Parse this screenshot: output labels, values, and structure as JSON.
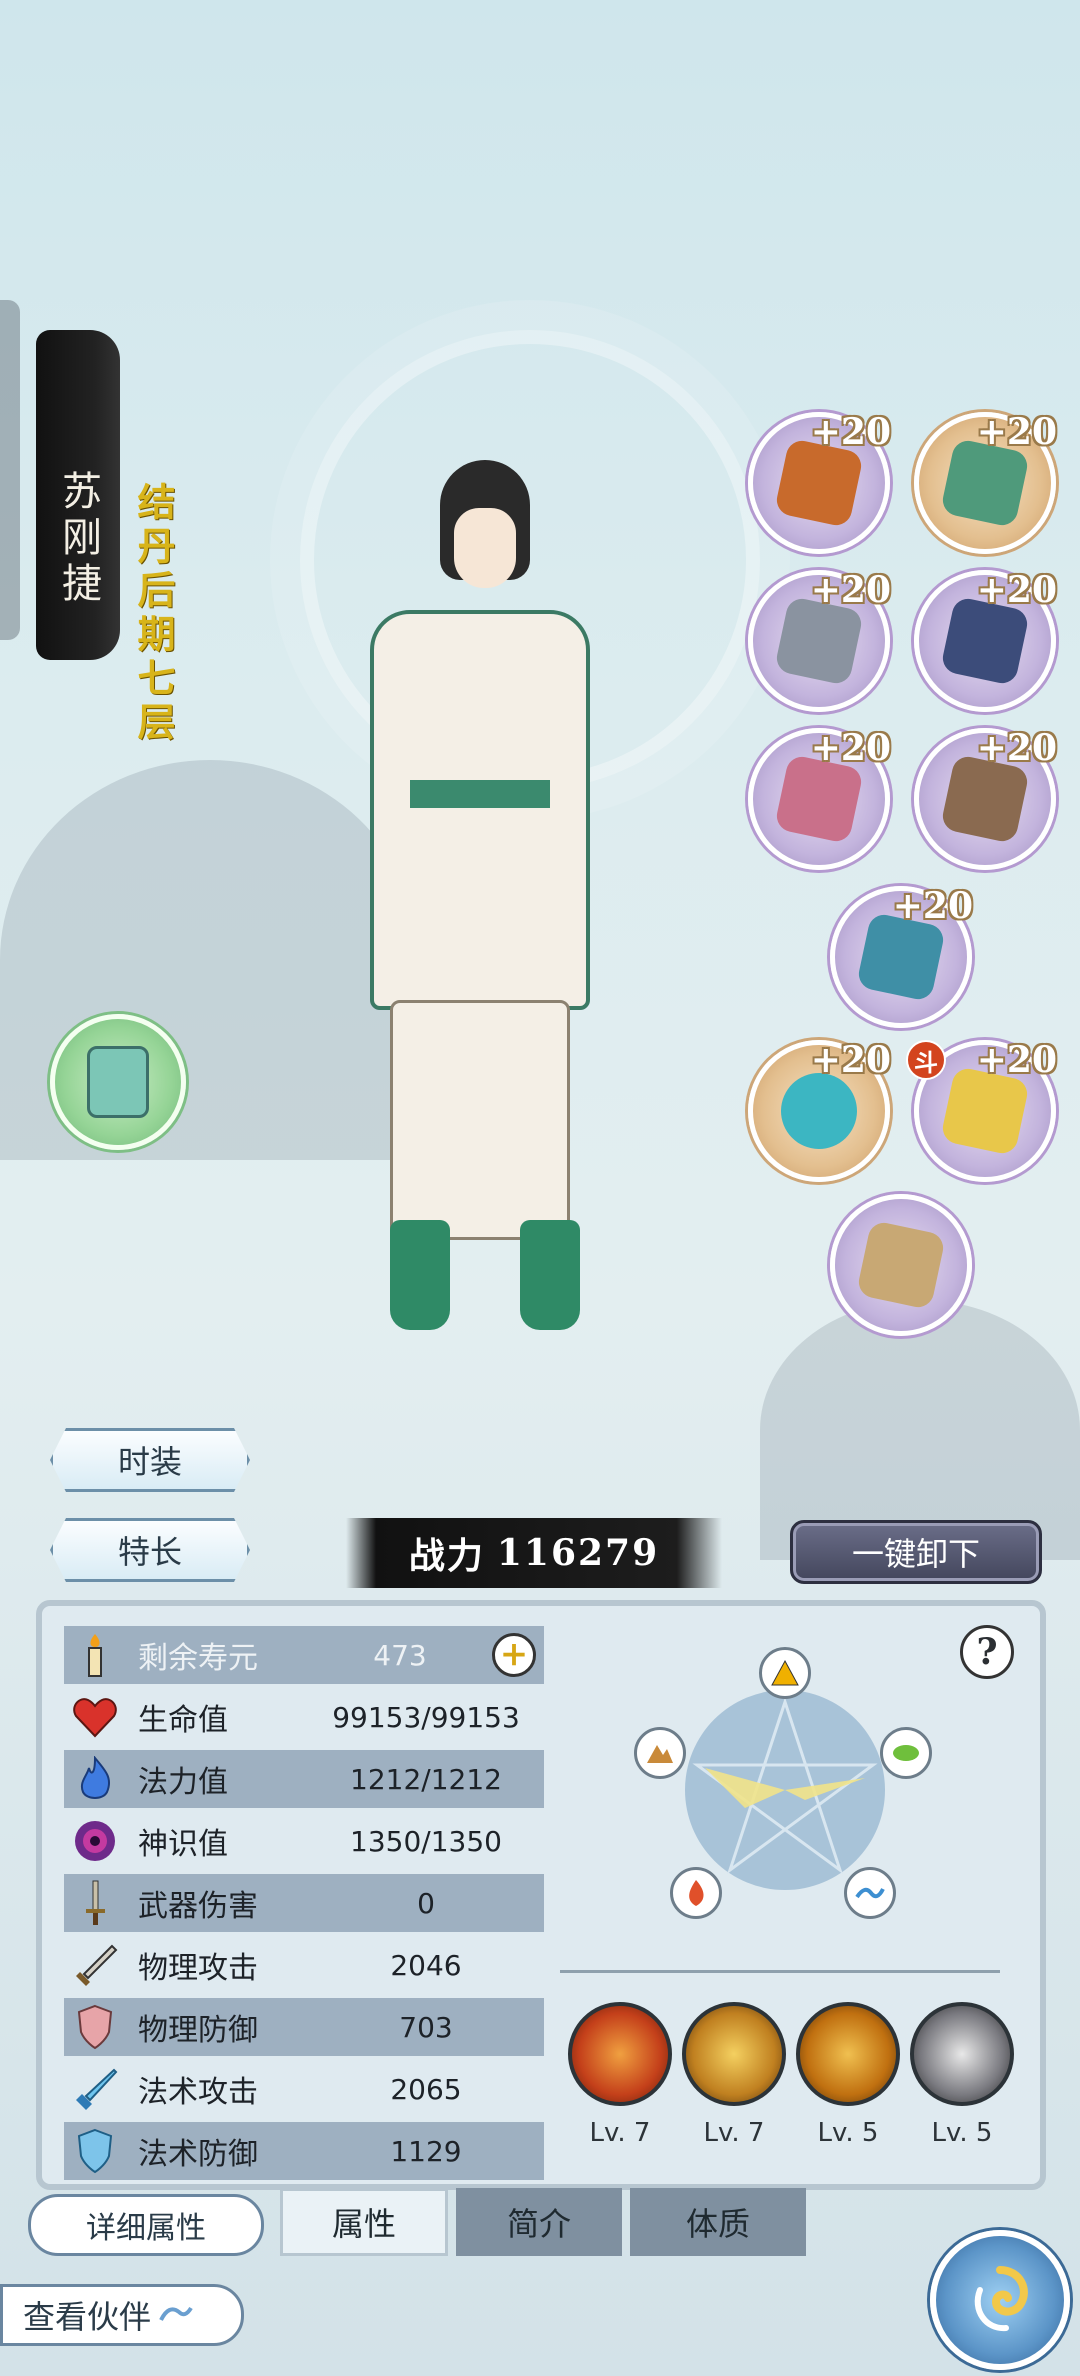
{
  "character": {
    "name": "苏刚捷",
    "realm": "结丹后期七层"
  },
  "equipment": {
    "enhance_label": "+20",
    "badge": "斗",
    "slots": [
      {
        "id": "robe",
        "color": "#c86a2c"
      },
      {
        "id": "headband",
        "color": "#4f9a7b"
      },
      {
        "id": "smoke-armor",
        "color": "#8a93a0"
      },
      {
        "id": "belt",
        "color": "#3c4c7a"
      },
      {
        "id": "pouch",
        "color": "#c9708a"
      },
      {
        "id": "bracelet",
        "color": "#8a6a50"
      },
      {
        "id": "flag",
        "color": "#3f8fa6"
      },
      {
        "id": "mirror",
        "color": "#3cb6c2"
      },
      {
        "id": "seal",
        "color": "#e8c74a"
      },
      {
        "id": "scroll",
        "color": "#c8a874"
      }
    ]
  },
  "buttons": {
    "fashion": "时装",
    "specialty": "特长",
    "unequip_all": "一键卸下",
    "detail_attributes": "详细属性",
    "view_partner": "查看伙伴"
  },
  "power": {
    "label": "战力",
    "value": "116279"
  },
  "stats": [
    {
      "label": "剩余寿元",
      "value": "473",
      "icon": "candle-icon"
    },
    {
      "label": "生命值",
      "value": "99153/99153",
      "icon": "heart-icon"
    },
    {
      "label": "法力值",
      "value": "1212/1212",
      "icon": "flame-icon"
    },
    {
      "label": "神识值",
      "value": "1350/1350",
      "icon": "vortex-icon"
    },
    {
      "label": "武器伤害",
      "value": "0",
      "icon": "sword-icon"
    },
    {
      "label": "物理攻击",
      "value": "2046",
      "icon": "blade-icon"
    },
    {
      "label": "物理防御",
      "value": "703",
      "icon": "shield-icon"
    },
    {
      "label": "法术攻击",
      "value": "2065",
      "icon": "crystal-sword-icon"
    },
    {
      "label": "法术防御",
      "value": "1129",
      "icon": "crystal-shield-icon"
    }
  ],
  "skills": [
    {
      "level": "Lv. 7",
      "color": "#d5531e"
    },
    {
      "level": "Lv. 7",
      "color": "#c88a2a"
    },
    {
      "level": "Lv. 5",
      "color": "#c77a1c"
    },
    {
      "level": "Lv. 5",
      "color": "#6b6f76"
    }
  ],
  "tabs": [
    {
      "label": "属性",
      "active": true
    },
    {
      "label": "简介",
      "active": false
    },
    {
      "label": "体质",
      "active": false
    }
  ],
  "help": "?"
}
